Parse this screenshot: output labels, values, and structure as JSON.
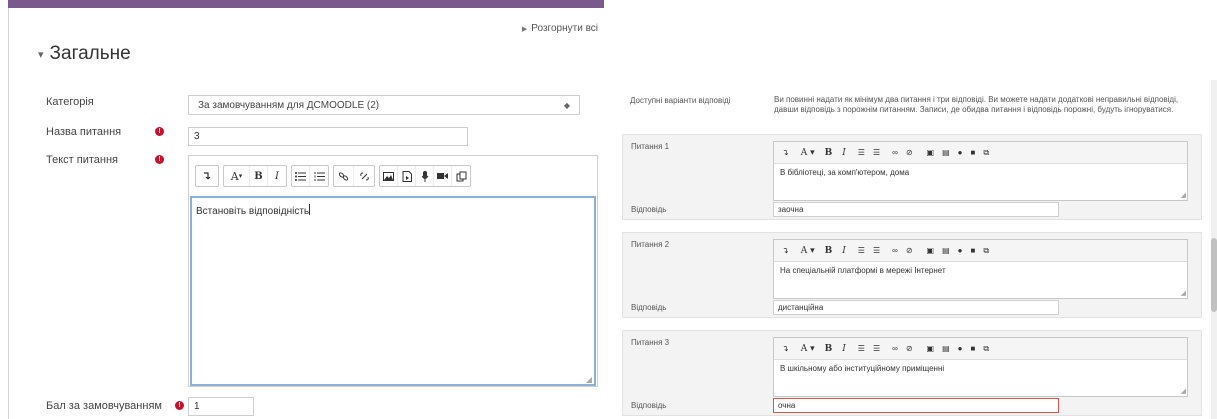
{
  "left": {
    "expand_all": "Розгорнути всі",
    "section_title": "Загальне",
    "fields": {
      "category_label": "Категорія",
      "category_value": "За замовчуванням для ДСMOODLE (2)",
      "name_label": "Назва питання",
      "name_value": "3",
      "text_label": "Текст питання",
      "text_value": "Встановіть відповідність",
      "mark_label": "Бал за замовчуванням",
      "mark_value": "1"
    },
    "toolbar": {
      "font_a": "A",
      "bold": "B",
      "italic": "I"
    }
  },
  "right": {
    "choices_label": "Доступні варіанти відповіді",
    "instructions": "Ви повинні надати як мінімум два питання і три відповіді. Ви можете надати додаткові неправильні відповіді, давши відповідь з порожнім питанням. Записи, де обидва питання і відповідь порожні, будуть ігноруватися.",
    "answer_label": "Відповідь",
    "questions": [
      {
        "label": "Питання 1",
        "text": "В бібліотеці, за комп'ютером, дома",
        "answer": "заочна"
      },
      {
        "label": "Питання 2",
        "text": "На спеціальній платформі в мережі Інтернет",
        "answer": "дистанційна"
      },
      {
        "label": "Питання 3",
        "text": "В шкільному або інституційному приміщенні",
        "answer": "очна"
      }
    ]
  },
  "colors": {
    "top_bar": "#7a5a8c",
    "required": "#c8102e",
    "focus_border": "#8cb0d6",
    "active_answer_border": "#d9534f"
  },
  "icons": [
    "dir-icon",
    "font-color-icon",
    "bold-icon",
    "italic-icon",
    "unordered-list-icon",
    "ordered-list-icon",
    "link-icon",
    "unlink-icon",
    "image-icon",
    "media-icon",
    "record-audio-icon",
    "record-video-icon",
    "manage-files-icon",
    "chevron-down-icon",
    "required-icon",
    "select-arrows-icon",
    "resize-handle-icon"
  ]
}
